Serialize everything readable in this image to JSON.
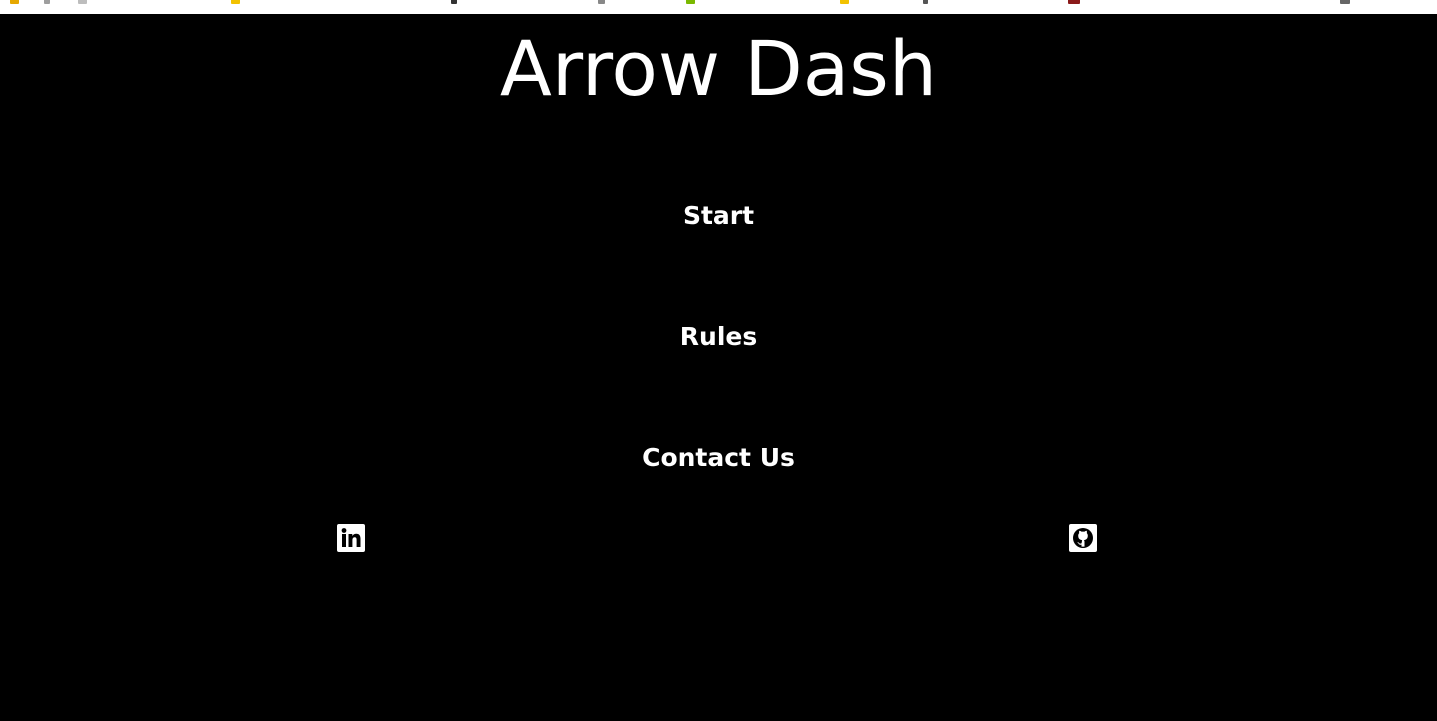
{
  "page": {
    "title": "Arrow Dash",
    "background": "#000000",
    "text_color": "#ffffff"
  },
  "menu": {
    "items": [
      {
        "label": "Start"
      },
      {
        "label": "Rules"
      },
      {
        "label": "Contact Us"
      }
    ]
  },
  "social": {
    "linkedin_icon": "linkedin-icon",
    "github_icon": "github-icon"
  }
}
